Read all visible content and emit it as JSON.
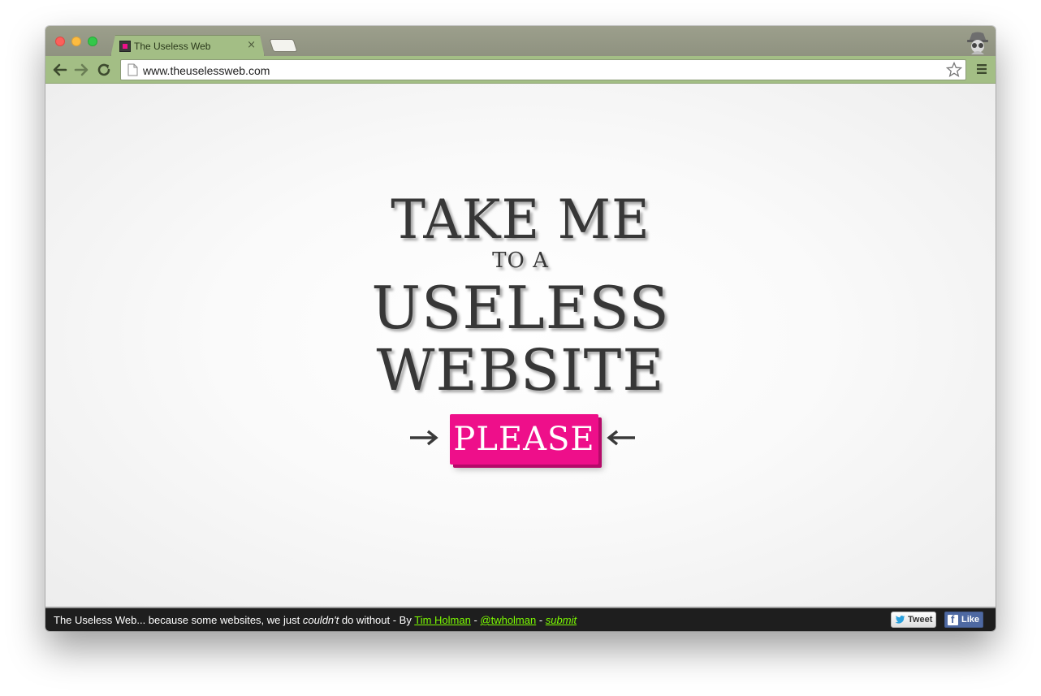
{
  "browser": {
    "tab_title": "The Useless Web",
    "tab_close": "×",
    "url": "www.theuselessweb.com"
  },
  "hero": {
    "line1": "TAKE ME",
    "line2": "TO A",
    "line3": "USELESS",
    "line4": "WEBSITE",
    "button_label": "PLEASE",
    "accent_color": "#ee0f8a"
  },
  "footer": {
    "text_before": "The Useless Web... because some websites, we just ",
    "text_em": "couldn't",
    "text_after": " do without - By ",
    "author_link": "Tim Holman",
    "separator1": " - ",
    "twitter_link": "@twholman",
    "separator2": " - ",
    "submit_link": "submit",
    "tweet_label": "Tweet",
    "like_label": "Like",
    "link_color": "#7cfc00"
  },
  "icons": [
    "back-arrow-icon",
    "forward-arrow-icon",
    "reload-icon",
    "page-icon",
    "star-icon",
    "menu-icon",
    "incognito-icon",
    "arrow-right-icon",
    "arrow-left-icon",
    "twitter-bird-icon",
    "facebook-icon"
  ]
}
